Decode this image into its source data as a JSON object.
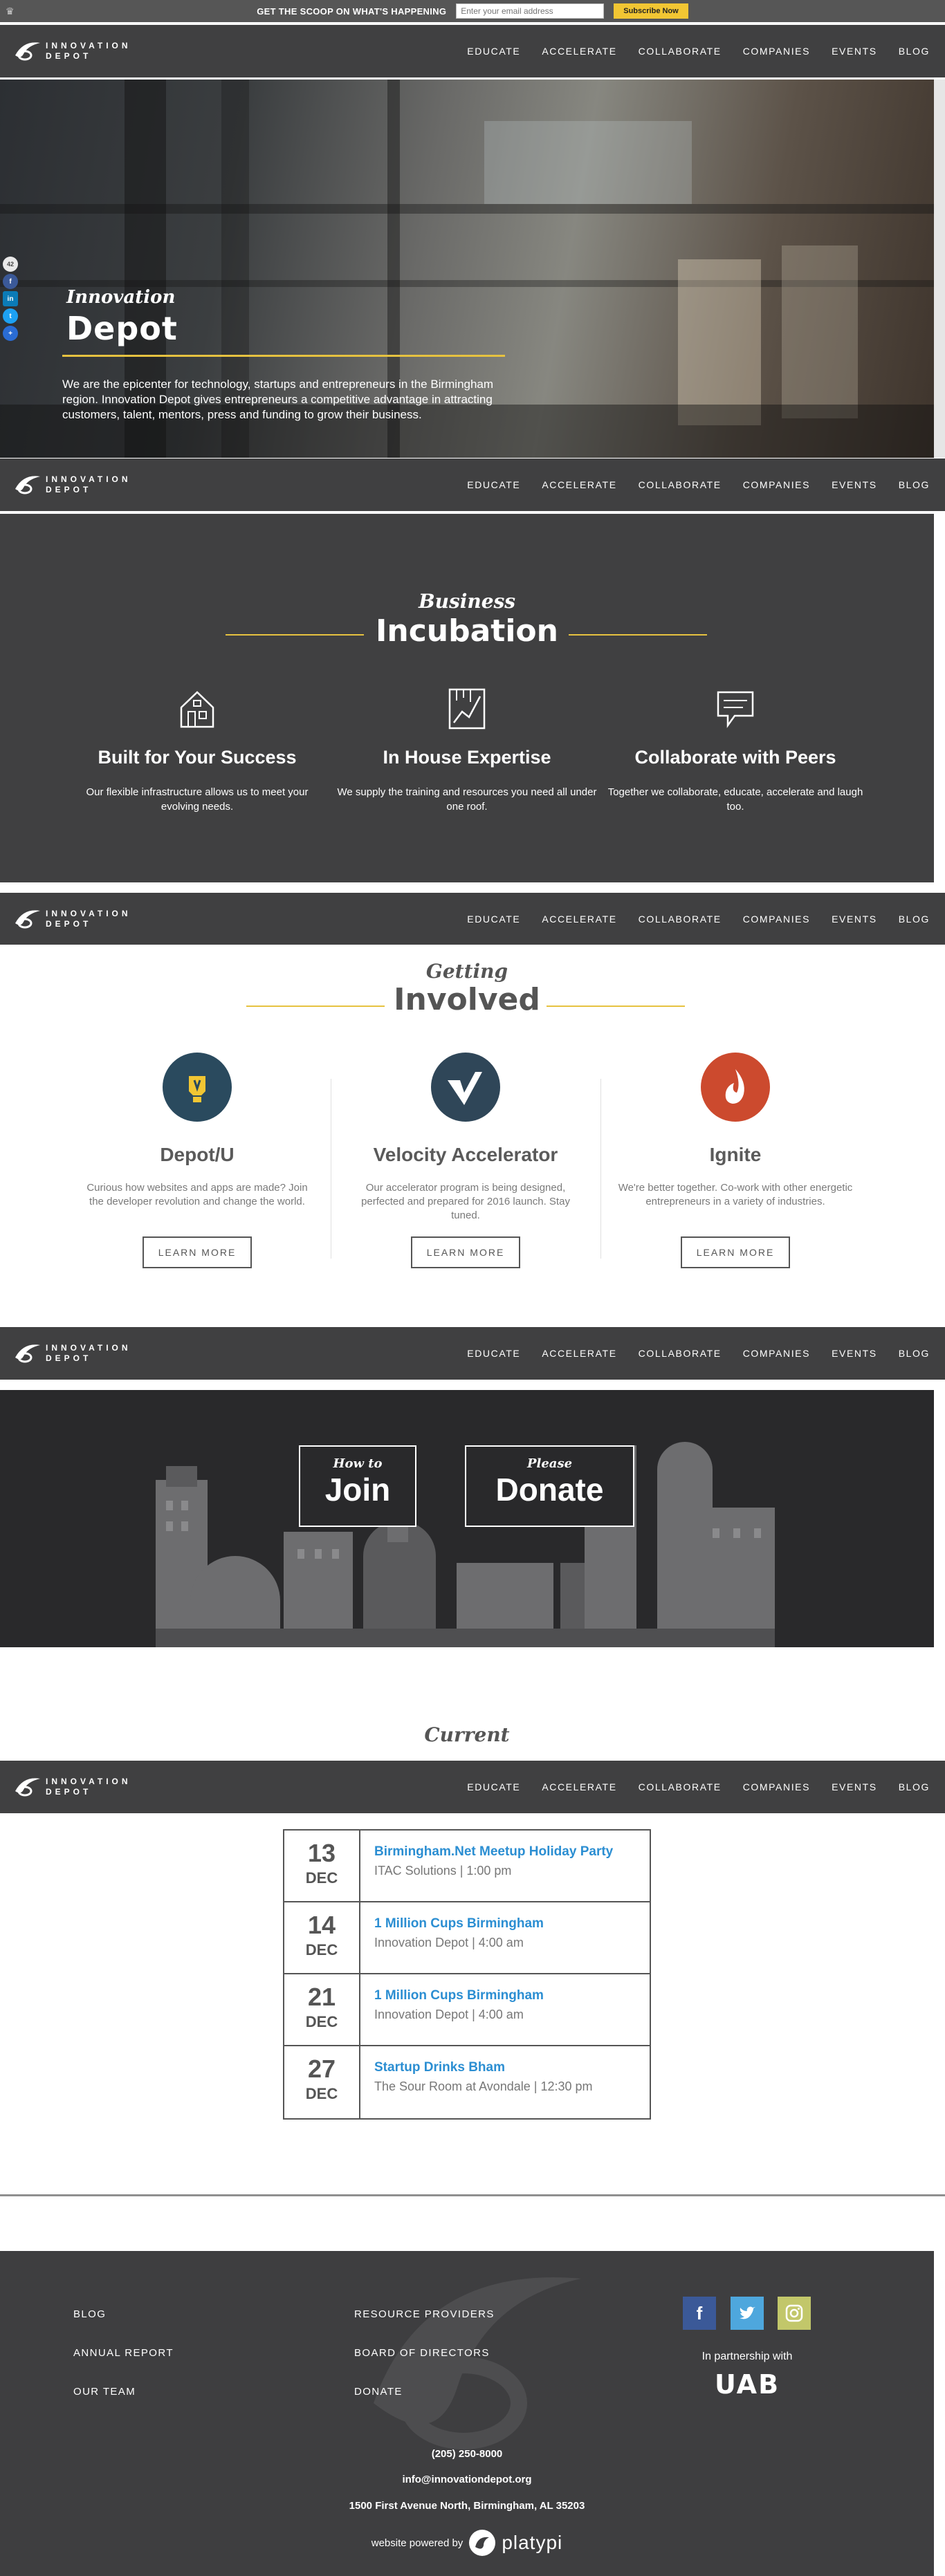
{
  "scoop": {
    "text": "GET THE SCOOP ON WHAT'S HAPPENING",
    "email_placeholder": "Enter your email address",
    "subscribe_label": "Subscribe Now"
  },
  "logo": {
    "line1": "INNOVATION",
    "line2": "DEPOT"
  },
  "nav": {
    "items": [
      "EDUCATE",
      "ACCELERATE",
      "COLLABORATE",
      "COMPANIES",
      "EVENTS",
      "BLOG"
    ]
  },
  "share": {
    "count": "42"
  },
  "hero": {
    "title_small": "Innovation",
    "title_big": "Depot",
    "text": "We are the epicenter for technology, startups and entrepreneurs in the Birmingham region. Innovation Depot gives entrepreneurs a competitive advantage in attracting customers, talent, mentors, press and funding to grow their business."
  },
  "incubation": {
    "script": "Business",
    "heading": "Incubation",
    "features": [
      {
        "icon": "house-icon",
        "title": "Built for Your Success",
        "text": "Our flexible infrastructure allows us to meet your evolving needs."
      },
      {
        "icon": "growth-chart-icon",
        "title": "In House Expertise",
        "text": "We supply the training and resources you need all under one roof."
      },
      {
        "icon": "chat-bubble-icon",
        "title": "Collaborate with Peers",
        "text": "Together we collaborate, educate, accelerate and laugh too."
      }
    ]
  },
  "involved": {
    "script": "Getting",
    "heading": "Involved",
    "columns": [
      {
        "icon": "lightbulb-icon",
        "color": "#2a4a5e",
        "title": "Depot/U",
        "text": "Curious how websites and apps are made? Join the developer revolution and change the world.",
        "button": "LEARN MORE"
      },
      {
        "icon": "velocity-v-icon",
        "color": "#2f4658",
        "title": "Velocity Accelerator",
        "text": "Our accelerator program is being designed, perfected and prepared for 2016 launch. Stay tuned.",
        "button": "LEARN MORE"
      },
      {
        "icon": "flame-icon",
        "color": "#cc4a2e",
        "title": "Ignite",
        "text": "We're better together. Co-work with other energetic entrepreneurs in a variety of industries.",
        "button": "LEARN MORE"
      }
    ]
  },
  "cta": {
    "join": {
      "script": "How to",
      "big": "Join"
    },
    "donate": {
      "script": "Please",
      "big": "Donate"
    }
  },
  "events": {
    "script": "Current",
    "rows": [
      {
        "day": "13",
        "month": "DEC",
        "title": "Birmingham.Net Meetup Holiday Party",
        "location": "ITAC Solutions | 1:00 pm"
      },
      {
        "day": "14",
        "month": "DEC",
        "title": "1 Million Cups Birmingham",
        "location": "Innovation Depot | 4:00 am"
      },
      {
        "day": "21",
        "month": "DEC",
        "title": "1 Million Cups Birmingham",
        "location": "Innovation Depot | 4:00 am"
      },
      {
        "day": "27",
        "month": "DEC",
        "title": "Startup Drinks Bham",
        "location": "The Sour Room at Avondale | 12:30 pm"
      }
    ]
  },
  "footer": {
    "links_left": [
      "BLOG",
      "ANNUAL REPORT",
      "OUR TEAM"
    ],
    "links_right": [
      "RESOURCE PROVIDERS",
      "BOARD OF DIRECTORS",
      "DONATE"
    ],
    "partner_text": "In partnership with",
    "partner_logo": "UAB",
    "phone": "(205) 250-8000",
    "email": "info@innovationdepot.org",
    "address": "1500 First Avenue North, Birmingham, AL 35203",
    "powered_label": "website powered by",
    "powered_name": "platypi",
    "social_colors": {
      "facebook": "#3b5998",
      "twitter": "#4ea7dd",
      "instagram": "#c2c76a"
    }
  },
  "colors": {
    "accent_yellow": "#e6c240",
    "nav_bg": "#404041",
    "link_blue": "#2b8ed2"
  }
}
